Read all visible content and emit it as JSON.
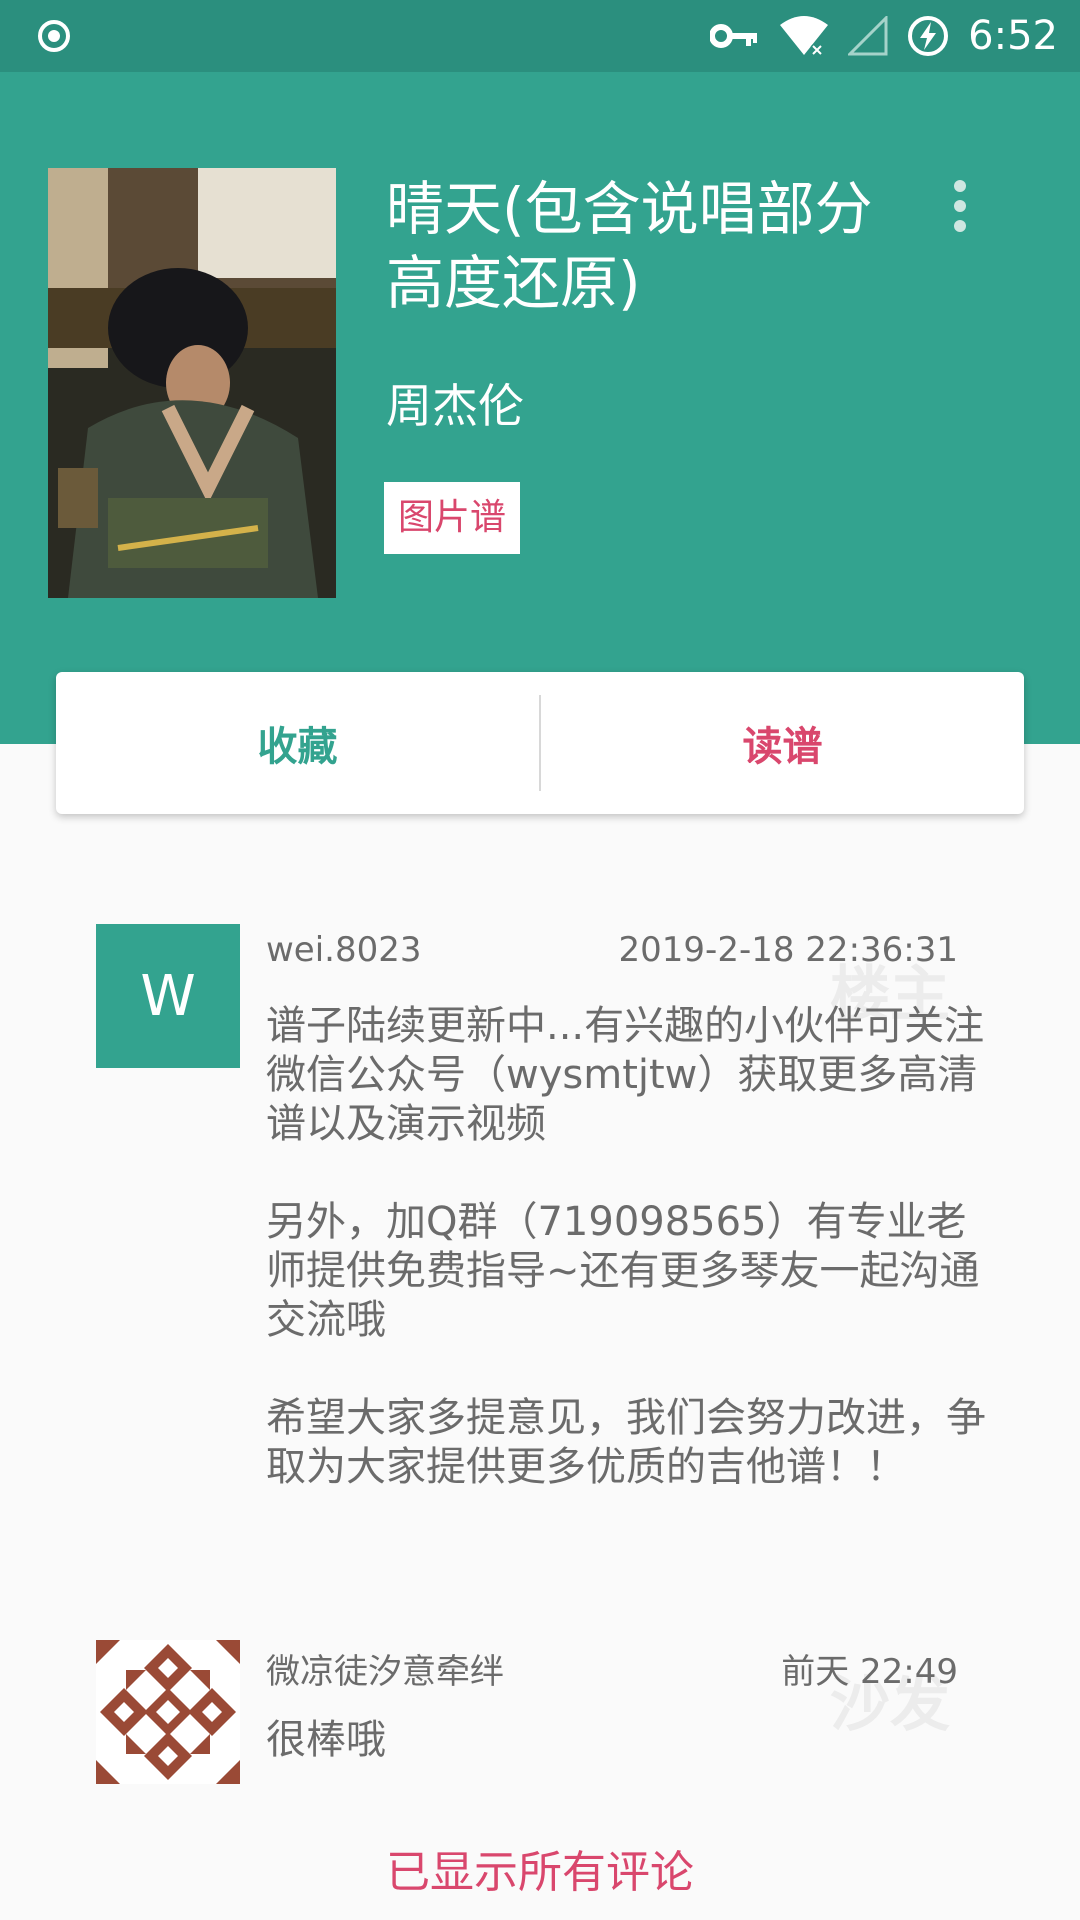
{
  "status_bar": {
    "time": "6:52"
  },
  "song": {
    "title": "晴天(包含说唱部分高度还原)",
    "artist": "周杰伦",
    "tag": "图片谱"
  },
  "actions": {
    "favorite": "收藏",
    "read": "读谱"
  },
  "comments": [
    {
      "avatar_letter": "W",
      "user": "wei.8023",
      "time": "2019-2-18 22:36:31",
      "badge": "楼主",
      "paragraphs": [
        "谱子陆续更新中...有兴趣的小伙伴可关注微信公众号（wysmtjtw）获取更多高清谱以及演示视频",
        "另外，加Q群（719098565）有专业老师提供免费指导~还有更多琴友一起沟通交流哦",
        "希望大家多提意见，我们会努力改进，争取为大家提供更多优质的吉他谱！！"
      ]
    },
    {
      "user": "微凉徒汐意牵绊",
      "time": "前天 22:49",
      "badge": "沙发",
      "text": "很棒哦"
    }
  ],
  "footer": "已显示所有评论",
  "colors": {
    "primary": "#33a38f",
    "status_bar": "#2b8f7e",
    "accent": "#d9476d"
  }
}
